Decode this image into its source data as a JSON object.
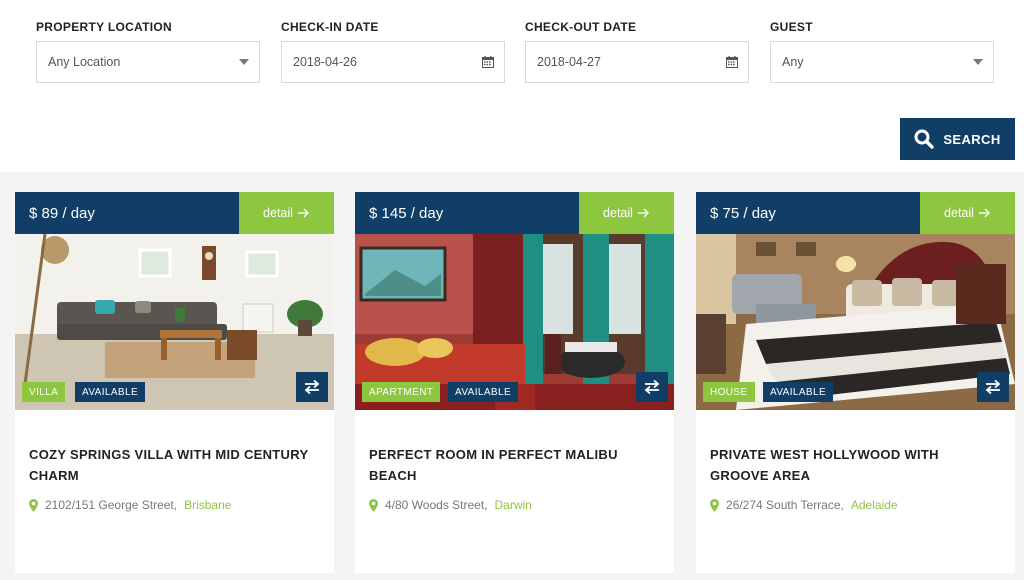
{
  "filters": {
    "location": {
      "label": "PROPERTY LOCATION",
      "value": "Any Location"
    },
    "checkin": {
      "label": "CHECK-IN DATE",
      "value": "2018-04-26"
    },
    "checkout": {
      "label": "CHECK-OUT DATE",
      "value": "2018-04-27"
    },
    "guest": {
      "label": "GUEST",
      "value": "Any"
    },
    "search_label": "SEARCH"
  },
  "colors": {
    "navy": "#103e66",
    "green": "#8dc63f",
    "background": "#f4f4f4"
  },
  "listings": [
    {
      "price": "$ 89 / day",
      "detail_label": "detail",
      "type": "VILLA",
      "status": "AVAILABLE",
      "title": "COZY SPRINGS VILLA WITH MID CENTURY CHARM",
      "address": "2102/151 George Street,",
      "city": "Brisbane",
      "image_alt": "living room with grey sofa"
    },
    {
      "price": "$ 145 / day",
      "detail_label": "detail",
      "type": "APARTMENT",
      "status": "AVAILABLE",
      "title": "PERFECT ROOM IN PERFECT MALIBU BEACH",
      "address": "4/80 Woods Street,",
      "city": "Darwin",
      "image_alt": "red bedroom with teal curtains"
    },
    {
      "price": "$ 75 / day",
      "detail_label": "detail",
      "type": "HOUSE",
      "status": "AVAILABLE",
      "title": "PRIVATE WEST HOLLYWOOD WITH GROOVE AREA",
      "address": "26/274 South Terrace,",
      "city": "Adelaide",
      "image_alt": "hotel bedroom with striped bedspread"
    }
  ]
}
